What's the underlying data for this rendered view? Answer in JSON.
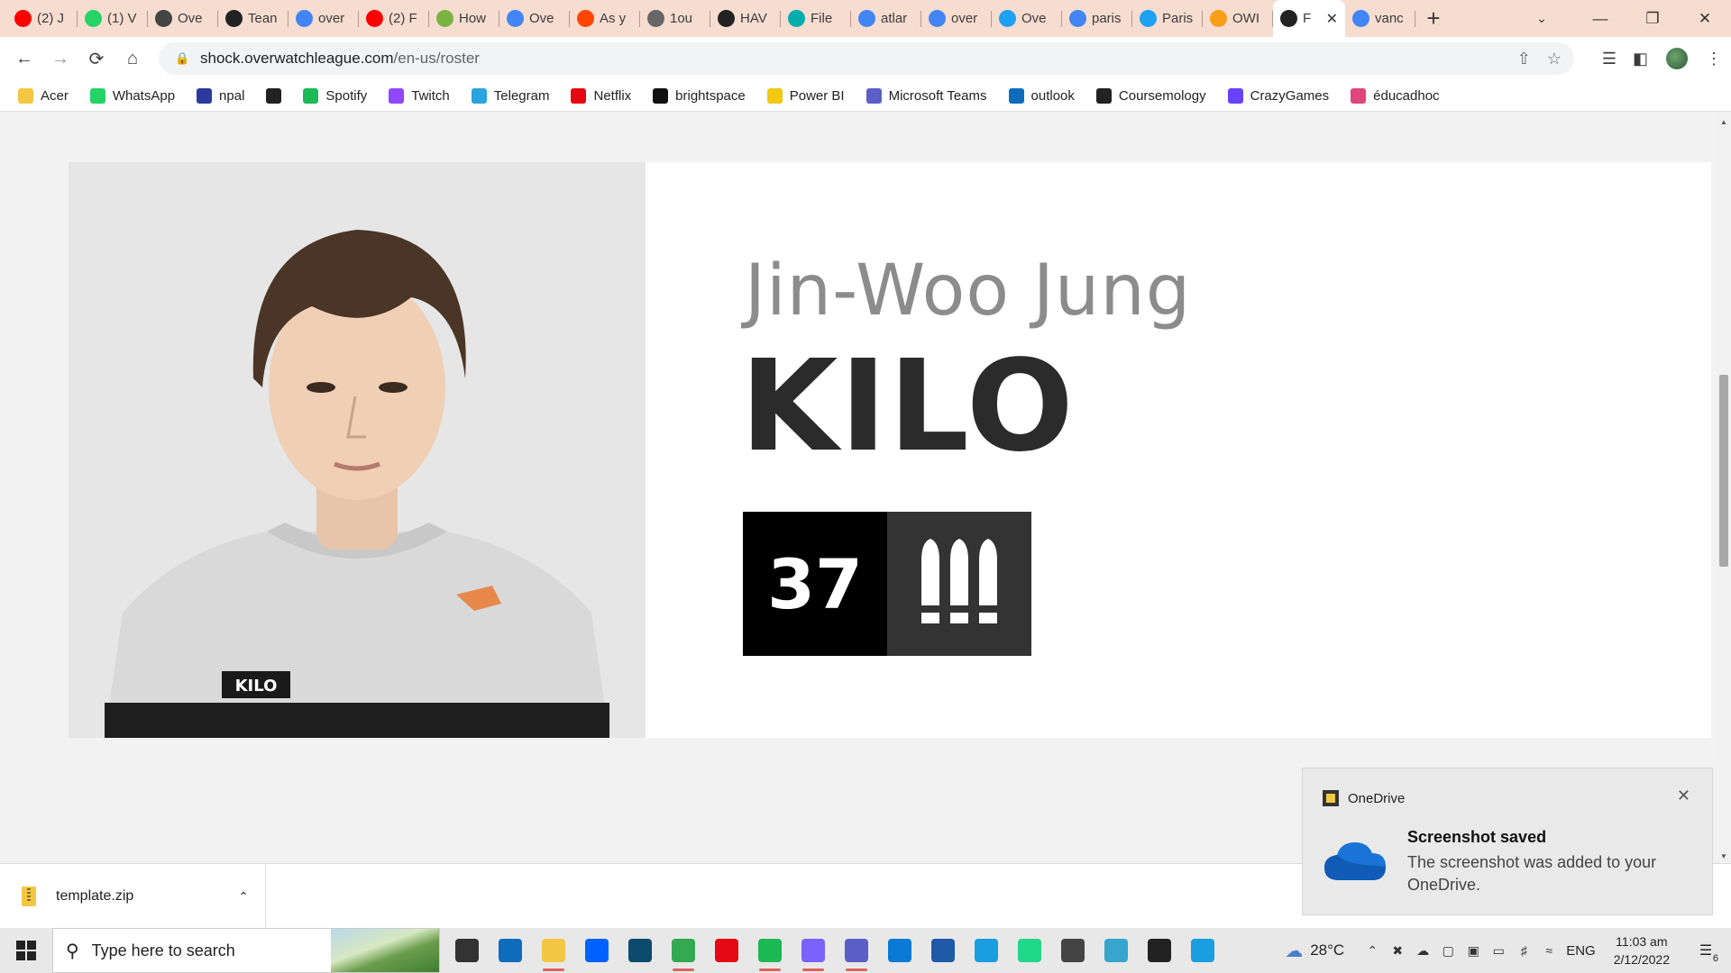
{
  "browser": {
    "tabs": [
      {
        "label": "(2) J",
        "icon": "youtube-icon",
        "color": "#ff0000"
      },
      {
        "label": "(1) V",
        "icon": "whatsapp-icon",
        "color": "#25d366"
      },
      {
        "label": "Ove",
        "icon": "overwatch-icon",
        "color": "#444444"
      },
      {
        "label": "Tean",
        "icon": "shock-icon",
        "color": "#222222"
      },
      {
        "label": "over",
        "icon": "google-icon",
        "color": "#4285f4"
      },
      {
        "label": "(2) F",
        "icon": "youtube-icon",
        "color": "#ff0000"
      },
      {
        "label": "How",
        "icon": "wikihow-icon",
        "color": "#7bb342"
      },
      {
        "label": "Ove",
        "icon": "google-icon",
        "color": "#4285f4"
      },
      {
        "label": "As y",
        "icon": "reddit-icon",
        "color": "#ff4500"
      },
      {
        "label": "1ou",
        "icon": "globe-icon",
        "color": "#666666"
      },
      {
        "label": "HAV",
        "icon": "shock-icon",
        "color": "#222222"
      },
      {
        "label": "File",
        "icon": "fandom-icon",
        "color": "#00acac"
      },
      {
        "label": "atlar",
        "icon": "google-icon",
        "color": "#4285f4"
      },
      {
        "label": "over",
        "icon": "google-icon",
        "color": "#4285f4"
      },
      {
        "label": "Ove",
        "icon": "twitter-icon",
        "color": "#1da1f2"
      },
      {
        "label": "paris",
        "icon": "google-icon",
        "color": "#4285f4"
      },
      {
        "label": "Paris",
        "icon": "twitter-icon",
        "color": "#1da1f2"
      },
      {
        "label": "OWI",
        "icon": "owl-icon",
        "color": "#f99e1a"
      },
      {
        "label": "F",
        "icon": "shock-icon",
        "color": "#222222",
        "active": true
      },
      {
        "label": "vanc",
        "icon": "google-icon",
        "color": "#4285f4"
      }
    ],
    "url_domain": "shock.overwatchleague.com",
    "url_path": "/en-us/roster"
  },
  "bookmarks": [
    {
      "label": "Acer",
      "icon": "folder-icon",
      "color": "#f3c744"
    },
    {
      "label": "WhatsApp",
      "icon": "whatsapp-icon",
      "color": "#25d366"
    },
    {
      "label": "npal",
      "icon": "npal-icon",
      "color": "#2b3a9c"
    },
    {
      "label": "",
      "icon": "globe-icon",
      "color": "#222222"
    },
    {
      "label": "Spotify",
      "icon": "spotify-icon",
      "color": "#1db954"
    },
    {
      "label": "Twitch",
      "icon": "twitch-icon",
      "color": "#9146ff"
    },
    {
      "label": "Telegram",
      "icon": "telegram-icon",
      "color": "#2aa3df"
    },
    {
      "label": "Netflix",
      "icon": "netflix-icon",
      "color": "#e50914"
    },
    {
      "label": "brightspace",
      "icon": "np-icon",
      "color": "#111111"
    },
    {
      "label": "Power BI",
      "icon": "powerbi-icon",
      "color": "#f2c811"
    },
    {
      "label": "Microsoft Teams",
      "icon": "teams-icon",
      "color": "#5b5fc7"
    },
    {
      "label": "outlook",
      "icon": "outlook-icon",
      "color": "#0f6cbd"
    },
    {
      "label": "Coursemology",
      "icon": "coursemology-icon",
      "color": "#222222"
    },
    {
      "label": "CrazyGames",
      "icon": "crazygames-icon",
      "color": "#6842ff"
    },
    {
      "label": "éducadhoc",
      "icon": "educadhoc-icon",
      "color": "#e0457b"
    }
  ],
  "player": {
    "full_name": "Jin-Woo Jung",
    "handle": "KILO",
    "number": "37",
    "role_icon": "damage-role-icon",
    "jersey_text": "KILO"
  },
  "download": {
    "filename": "template.zip"
  },
  "toast": {
    "app": "OneDrive",
    "title": "Screenshot saved",
    "body": "The screenshot was added to your OneDrive."
  },
  "taskbar": {
    "search_placeholder": "Type here to search",
    "apps": [
      {
        "icon": "task-view-icon",
        "color": "#333333",
        "running": false
      },
      {
        "icon": "mail-icon",
        "color": "#0f6cbd",
        "running": false
      },
      {
        "icon": "file-explorer-icon",
        "color": "#f3c744",
        "running": true
      },
      {
        "icon": "dropbox-icon",
        "color": "#0061fe",
        "running": false
      },
      {
        "icon": "app-icon",
        "color": "#0c4a6e",
        "running": false
      },
      {
        "icon": "chrome-icon",
        "color": "#34a853",
        "running": true
      },
      {
        "icon": "netflix-icon",
        "color": "#e50914",
        "running": false
      },
      {
        "icon": "spotify-icon",
        "color": "#1db954",
        "running": true
      },
      {
        "icon": "messenger-icon",
        "color": "#7b61ff",
        "running": true
      },
      {
        "icon": "teams-icon",
        "color": "#5b5fc7",
        "running": true
      },
      {
        "icon": "vscode-icon",
        "color": "#0a7ad4",
        "running": false
      },
      {
        "icon": "photos-icon",
        "color": "#1e5aa8",
        "running": false
      },
      {
        "icon": "edge-icon",
        "color": "#1b9de2",
        "running": false
      },
      {
        "icon": "pycharm-icon",
        "color": "#21d789",
        "running": false
      },
      {
        "icon": "unity-icon",
        "color": "#444444",
        "running": false
      },
      {
        "icon": "maya-icon",
        "color": "#37a5cc",
        "running": false
      },
      {
        "icon": "unity-hub-icon",
        "color": "#222222",
        "running": false
      },
      {
        "icon": "edge-dev-icon",
        "color": "#1b9de2",
        "running": false
      }
    ],
    "weather": "28°C",
    "language": "ENG",
    "time": "11:03 am",
    "date": "2/12/2022",
    "notification_count": "6"
  }
}
